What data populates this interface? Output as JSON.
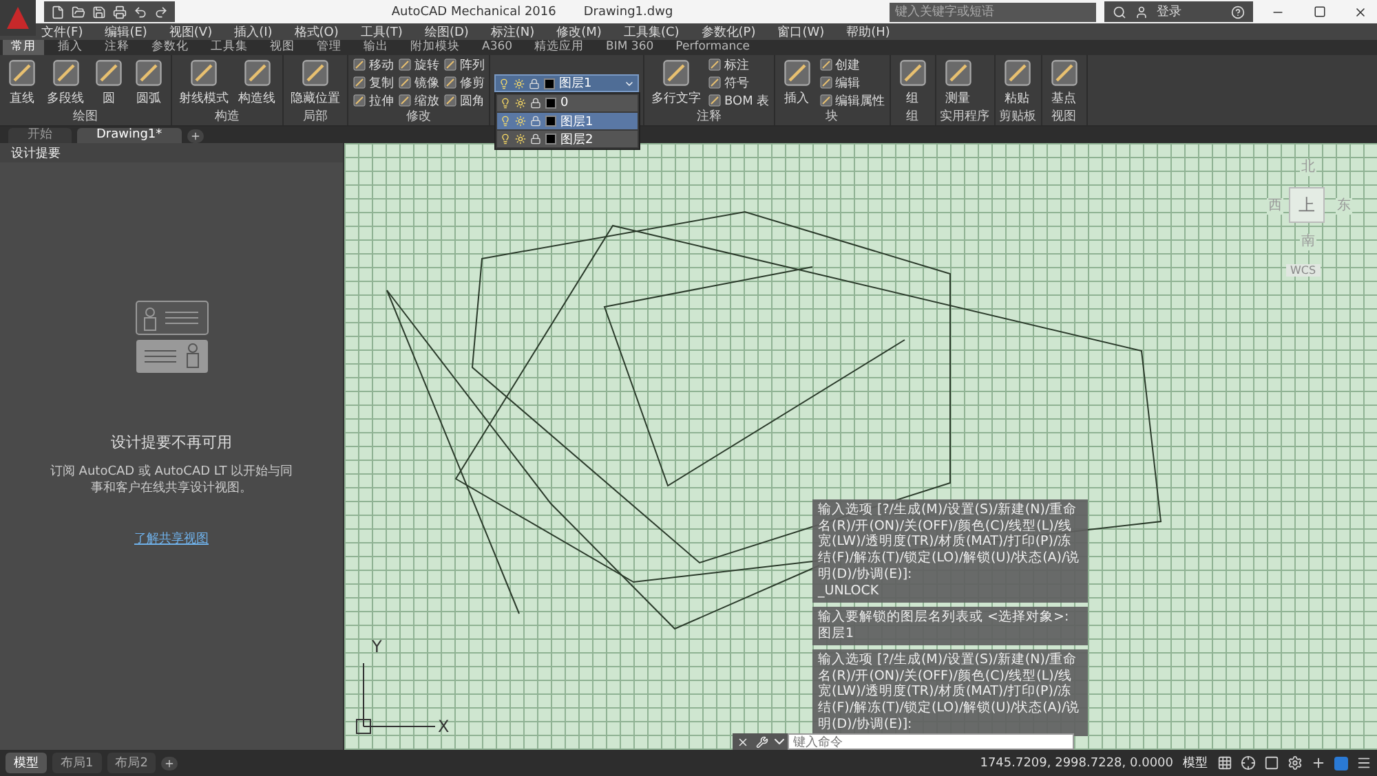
{
  "title_bar": {
    "app_name": "AutoCAD Mechanical 2016",
    "file_name": "Drawing1.dwg",
    "search": {
      "placeholder": "键入关键字或短语"
    },
    "sign_in": "登录"
  },
  "menu_bar": [
    "文件(F)",
    "编辑(E)",
    "视图(V)",
    "插入(I)",
    "格式(O)",
    "工具(T)",
    "绘图(D)",
    "标注(N)",
    "修改(M)",
    "工具集(C)",
    "参数化(P)",
    "窗口(W)",
    "帮助(H)"
  ],
  "ribbon_tabs": [
    {
      "label": "常用",
      "selected": true
    },
    {
      "label": "插入",
      "selected": false
    },
    {
      "label": "注释",
      "selected": false
    },
    {
      "label": "参数化",
      "selected": false
    },
    {
      "label": "工具集",
      "selected": false
    },
    {
      "label": "视图",
      "selected": false
    },
    {
      "label": "管理",
      "selected": false
    },
    {
      "label": "输出",
      "selected": false
    },
    {
      "label": "附加模块",
      "selected": false
    },
    {
      "label": "A360",
      "selected": false
    },
    {
      "label": "精选应用",
      "selected": false
    },
    {
      "label": "BIM 360",
      "selected": false
    },
    {
      "label": "Performance",
      "selected": false
    }
  ],
  "ribbon_panels": [
    {
      "kind": "tools",
      "title": "绘图",
      "columns": [
        {
          "kind": "large",
          "label": "直线"
        },
        {
          "kind": "large",
          "label": "多段线"
        },
        {
          "kind": "large",
          "label": "圆"
        },
        {
          "kind": "large",
          "label": "圆弧"
        }
      ]
    },
    {
      "kind": "tools",
      "title": "构造",
      "columns": [
        {
          "kind": "large",
          "label": "射线模式"
        },
        {
          "kind": "large",
          "label": "构造线"
        }
      ]
    },
    {
      "kind": "tools",
      "title": "局部",
      "columns": [
        {
          "kind": "large",
          "label": "隐藏位置"
        }
      ]
    },
    {
      "kind": "tools",
      "title": "修改",
      "columns": [
        {
          "kind": "stack",
          "tools": [
            "移动",
            "复制",
            "拉伸"
          ]
        },
        {
          "kind": "stack",
          "tools": [
            "旋转",
            "镜像",
            "缩放"
          ]
        },
        {
          "kind": "stack",
          "tools": [
            "阵列",
            "修剪",
            "圆角"
          ]
        }
      ]
    },
    {
      "kind": "layers",
      "current": "图层1",
      "layers": [
        {
          "name": "0",
          "selected": false
        },
        {
          "name": "图层1",
          "selected": true
        },
        {
          "name": "图层2",
          "selected": false
        }
      ]
    },
    {
      "kind": "tools",
      "title": "注释",
      "columns": [
        {
          "kind": "large",
          "label": "多行文字"
        },
        {
          "kind": "stack",
          "tools": [
            "标注",
            "符号",
            "BOM 表"
          ]
        }
      ]
    },
    {
      "kind": "tools",
      "title": "块",
      "columns": [
        {
          "kind": "large",
          "label": "插入"
        },
        {
          "kind": "stack",
          "tools": [
            "创建",
            "编辑",
            "编辑属性"
          ]
        }
      ]
    },
    {
      "kind": "tools",
      "title": "组",
      "columns": [
        {
          "kind": "large",
          "label": "组"
        }
      ]
    },
    {
      "kind": "tools",
      "title": "实用程序",
      "columns": [
        {
          "kind": "large",
          "label": "测量"
        }
      ]
    },
    {
      "kind": "tools",
      "title": "剪贴板",
      "columns": [
        {
          "kind": "large",
          "label": "粘贴"
        }
      ]
    },
    {
      "kind": "tools",
      "title": "视图",
      "columns": [
        {
          "kind": "large",
          "label": "基点"
        }
      ]
    }
  ],
  "document_tabs": [
    {
      "label": "开始",
      "selected": false
    },
    {
      "label": "Drawing1*",
      "selected": true
    }
  ],
  "design_feed": {
    "title": "设计提要",
    "heading": "设计提要不再可用",
    "message": "订阅 AutoCAD 或 AutoCAD LT 以开始与同事和客户在线共享设计视图。",
    "link": "了解共享视图"
  },
  "viewcube": {
    "north": "北",
    "south": "南",
    "east": "东",
    "west": "西",
    "face": "上",
    "coordinate_system": "WCS"
  },
  "ucs_icon": {
    "x_label": "X",
    "y_label": "Y"
  },
  "command_history": [
    {
      "lines": [
        "输入选项 [?/生成(M)/设置(S)/新建(N)/重命名(R)/开(ON)/关(OFF)/颜色(C)/线型(L)/线宽(LW)/透明度(TR)/材质(MAT)/打印(P)/冻结(F)/解冻(T)/锁定(LO)/解锁(U)/状态(A)/说明(D)/协调(E)]:",
        "_UNLOCK"
      ]
    },
    {
      "lines": [
        "输入要解锁的图层名列表或 <选择对象>: 图层1"
      ]
    },
    {
      "lines": [
        "输入选项 [?/生成(M)/设置(S)/新建(N)/重命名(R)/开(ON)/关(OFF)/颜色(C)/线型(L)/线宽(LW)/透明度(TR)/材质(MAT)/打印(P)/冻结(F)/解冻(T)/锁定(LO)/解锁(U)/状态(A)/说明(D)/协调(E)]:"
      ]
    }
  ],
  "command_line": {
    "placeholder": "键入命令"
  },
  "layout_tabs": [
    {
      "label": "模型",
      "selected": true
    },
    {
      "label": "布局1",
      "selected": false
    },
    {
      "label": "布局2",
      "selected": false
    }
  ],
  "status_bar": {
    "coordinates": "1745.7209, 2998.7228, 0.0000",
    "space": "模型"
  }
}
